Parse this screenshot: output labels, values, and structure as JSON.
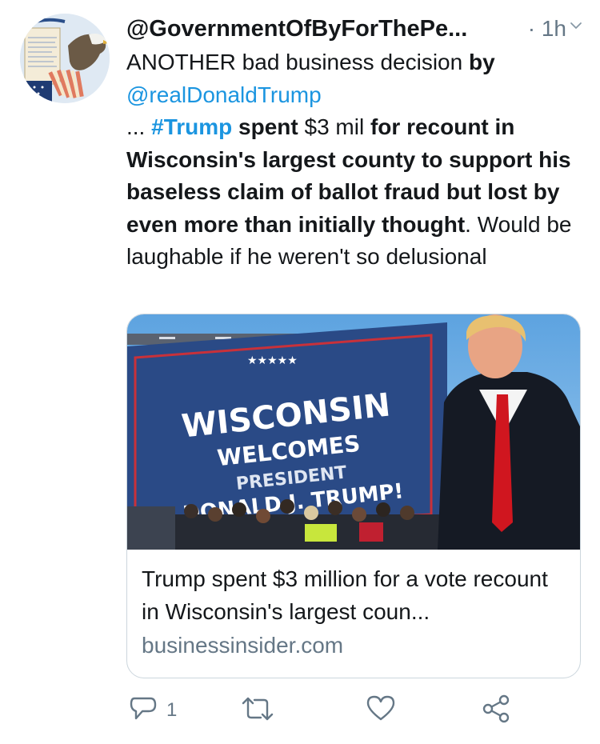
{
  "tweet": {
    "handle": "@GovernmentOfByForThePe...",
    "time": "· 1h",
    "body": {
      "p1": "ANOTHER bad business decision ",
      "p2": "by",
      "mention": "@realDonaldTrump",
      "p3": "... ",
      "hashtag": "#Trump",
      "p4": " spent ",
      "p5": "$3 mil ",
      "p6": "for  recount in Wisconsin's largest county to support his baseless claim of ballot fraud but lost by even more than initially thought",
      "p7": ". Would be laughable if he weren't so delusional"
    }
  },
  "card": {
    "image": {
      "sign_line1": "WISCONSIN",
      "sign_line2": "WELCOMES",
      "sign_line3": "PRESIDENT",
      "sign_line4": "DONALD J. TRUMP!",
      "sign_stars": "★★★★★"
    },
    "title": "Trump spent $3 million for a vote recount in Wisconsin's largest coun...",
    "domain": "businessinsider.com"
  },
  "actions": {
    "reply_count": "1",
    "retweet_count": "",
    "like_count": ""
  },
  "colors": {
    "link": "#1b95e0",
    "secondary": "#657786",
    "border": "#ccd6dd"
  }
}
